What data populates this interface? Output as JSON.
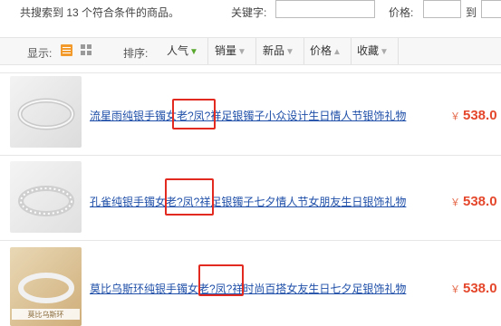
{
  "search": {
    "result_count_text": "共搜索到 13 个符合条件的商品。",
    "keyword_label": "关键字:",
    "keyword_value": "",
    "price_label": "价格:",
    "price_min": "",
    "to_label": "到",
    "price_max": ""
  },
  "sortbar": {
    "display_label": "显示:",
    "sort_label": "排序:",
    "options": [
      {
        "label": "人气",
        "arrow": "arrow-down-icon",
        "active": true
      },
      {
        "label": "销量",
        "arrow": "arrow-down-icon",
        "active": false
      },
      {
        "label": "新品",
        "arrow": "arrow-down-icon",
        "active": false
      },
      {
        "label": "价格",
        "arrow": "arrow-up-icon",
        "active": false
      },
      {
        "label": "收藏",
        "arrow": "arrow-down-icon",
        "active": false
      }
    ]
  },
  "products": [
    {
      "title": "流星雨纯银手镯女老?凤?祥足银镯子小众设计生日情人节银饰礼物",
      "currency": "￥",
      "price": "538.0",
      "highlight": "老?凤?祥"
    },
    {
      "title": "孔雀纯银手镯女老?凤?祥足银镯子七夕情人节女朋友生日银饰礼物",
      "currency": "￥",
      "price": "538.0",
      "highlight": "老?凤?祥"
    },
    {
      "title": "莫比乌斯环纯银手镯女老?凤?祥时尚百搭女友生日七夕足银饰礼物",
      "currency": "￥",
      "price": "538.0",
      "highlight": "老?凤?祥",
      "image_caption": "莫比乌斯环"
    }
  ],
  "colors": {
    "link": "#1f4fa8",
    "price": "#e4472b",
    "highlight_box": "#e32a20",
    "active_sort_arrow": "#59a82e",
    "list_view_icon": "#f39a2c"
  }
}
